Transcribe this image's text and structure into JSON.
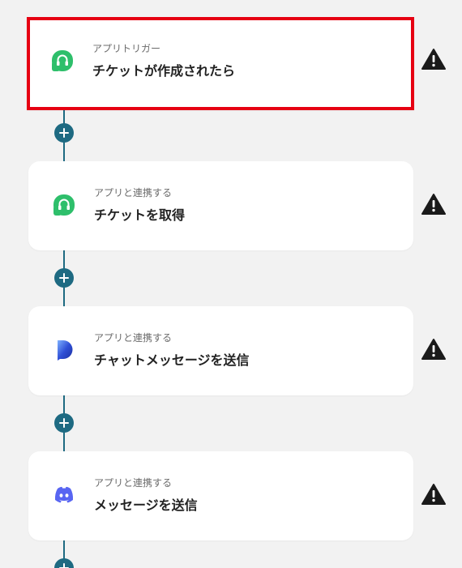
{
  "flow": {
    "steps": [
      {
        "kind": "アプリトリガー",
        "title": "チケットが作成されたら",
        "icon": "headset-app-icon",
        "selected": true,
        "warning": true
      },
      {
        "kind": "アプリと連携する",
        "title": "チケットを取得",
        "icon": "headset-app-icon",
        "selected": false,
        "warning": true
      },
      {
        "kind": "アプリと連携する",
        "title": "チャットメッセージを送信",
        "icon": "dialpad-app-icon",
        "selected": false,
        "warning": true
      },
      {
        "kind": "アプリと連携する",
        "title": "メッセージを送信",
        "icon": "discord-app-icon",
        "selected": false,
        "warning": true
      }
    ]
  },
  "colors": {
    "background": "#f2f2f2",
    "card": "#ffffff",
    "selected_border": "#e60012",
    "connector": "#1e6a82",
    "warning": "#1a1a1a",
    "headset_green": "#2ebf6b",
    "dialpad_blue": "#2f4fd6",
    "discord_blurple": "#5865f2"
  }
}
